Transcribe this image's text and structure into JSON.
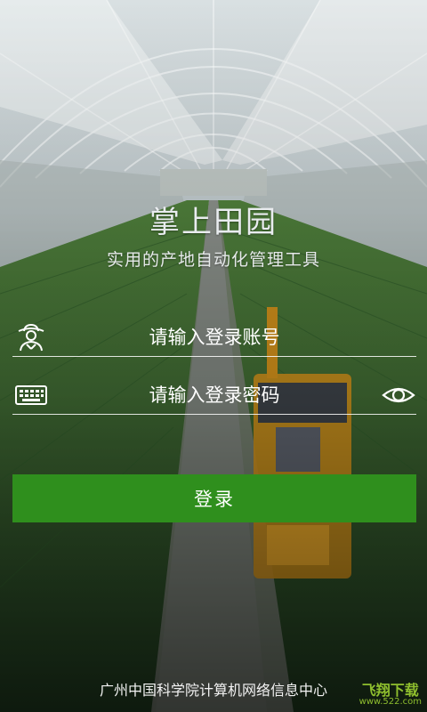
{
  "app": {
    "title": "掌上田园",
    "subtitle": "实用的产地自动化管理工具"
  },
  "login": {
    "account_placeholder": "请输入登录账号",
    "password_placeholder": "请输入登录密码",
    "submit_label": "登录"
  },
  "footer": {
    "org": "广州中国科学院计算机网络信息中心"
  },
  "watermark": {
    "line1": "飞翔下载",
    "line2": "www.522.com"
  },
  "icons": {
    "account": "farmer-icon",
    "password": "keyboard-icon",
    "toggle": "eye-icon"
  },
  "colors": {
    "login_button": "#2f8f1d",
    "field_line": "#ffffff"
  }
}
